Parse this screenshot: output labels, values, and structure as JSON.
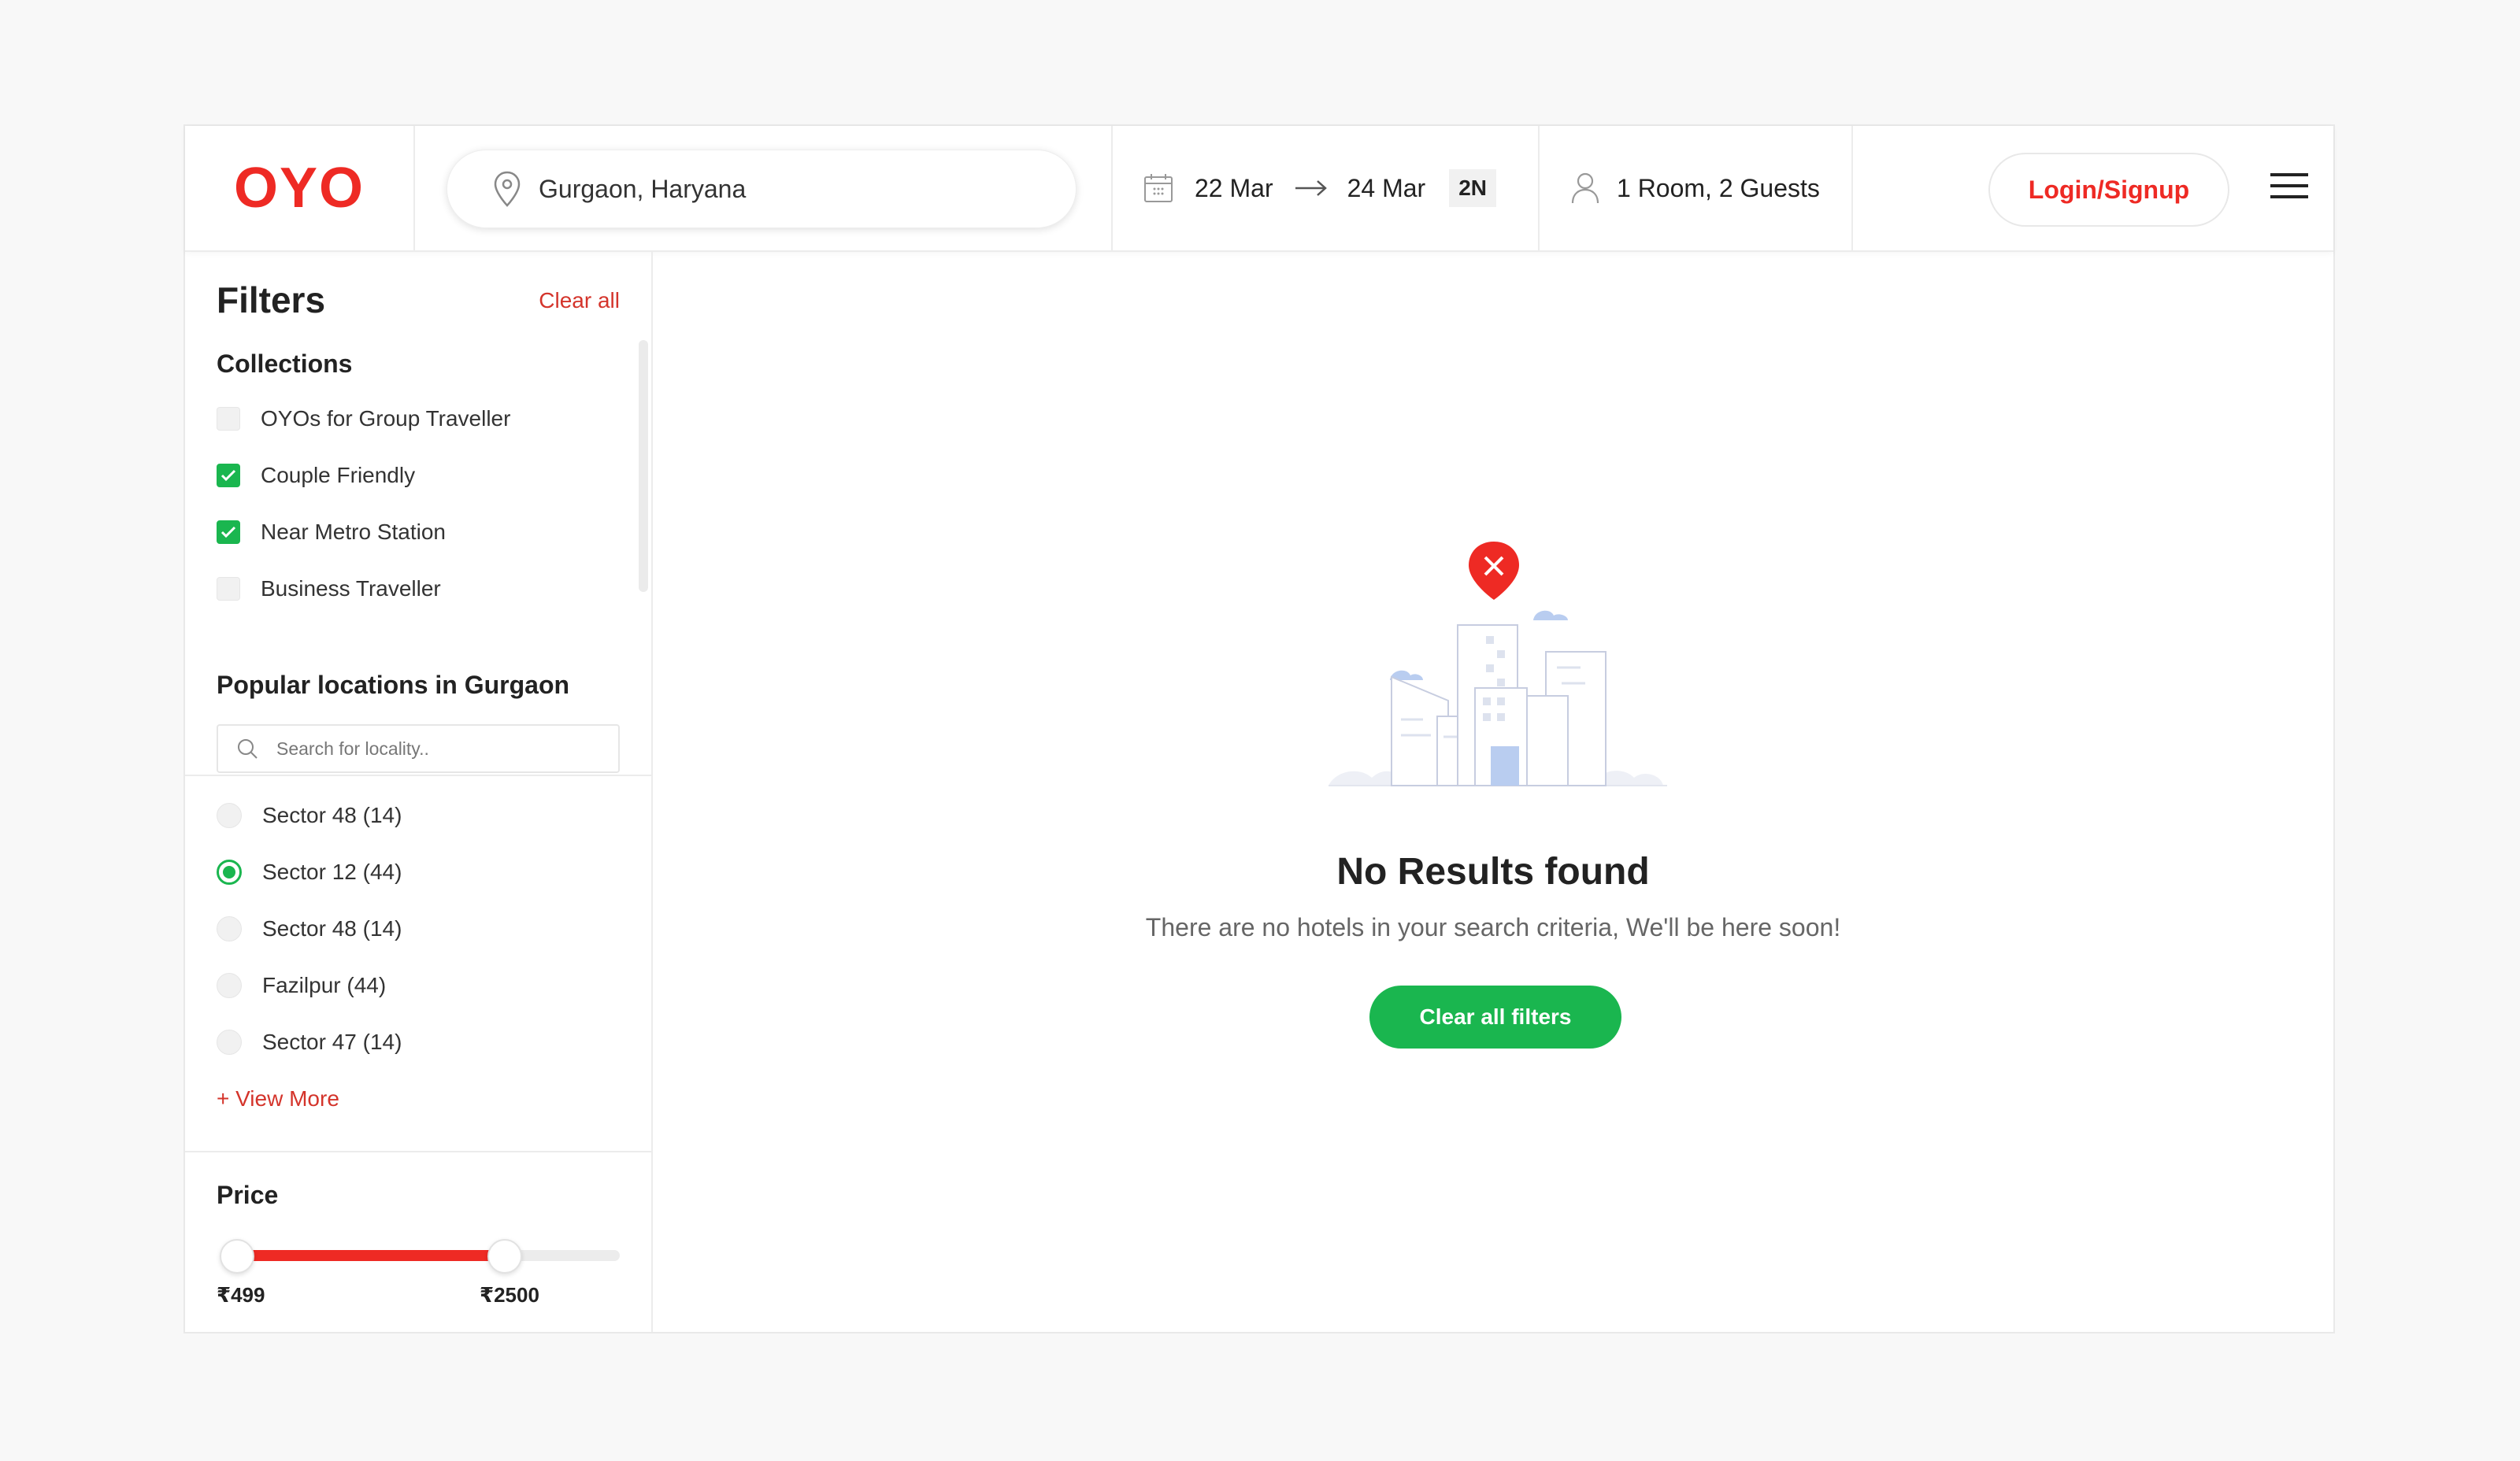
{
  "header": {
    "logo": "OYO",
    "location": "Gurgaon, Haryana",
    "checkin": "22 Mar",
    "checkout": "24 Mar",
    "nights": "2N",
    "guests": "1 Room, 2 Guests",
    "login_label": "Login/Signup"
  },
  "sidebar": {
    "title": "Filters",
    "clear_all": "Clear all",
    "collections": {
      "title": "Collections",
      "items": [
        {
          "label": "OYOs for Group Traveller",
          "checked": false
        },
        {
          "label": "Couple Friendly",
          "checked": true
        },
        {
          "label": "Near Metro Station",
          "checked": true
        },
        {
          "label": "Business Traveller",
          "checked": false
        }
      ]
    },
    "locations": {
      "title": "Popular locations in Gurgaon",
      "search_placeholder": "Search for locality..",
      "items": [
        {
          "label": "Sector 48 (14)",
          "selected": false
        },
        {
          "label": "Sector 12 (44)",
          "selected": true
        },
        {
          "label": "Sector 48 (14)",
          "selected": false
        },
        {
          "label": "Fazilpur (44)",
          "selected": false
        },
        {
          "label": "Sector 47 (14)",
          "selected": false
        }
      ],
      "view_more": "+ View More"
    },
    "price": {
      "title": "Price",
      "min_label": "₹499",
      "max_label": "₹2500",
      "min_fraction": 0.0,
      "max_fraction": 0.7
    }
  },
  "main": {
    "empty_title": "No Results found",
    "empty_subtitle": "There are no hotels in your search criteria, We'll be here soon!",
    "clear_filters_label": "Clear all filters"
  },
  "colors": {
    "brand_red": "#ee2a24",
    "accent_green": "#1ab64f"
  }
}
